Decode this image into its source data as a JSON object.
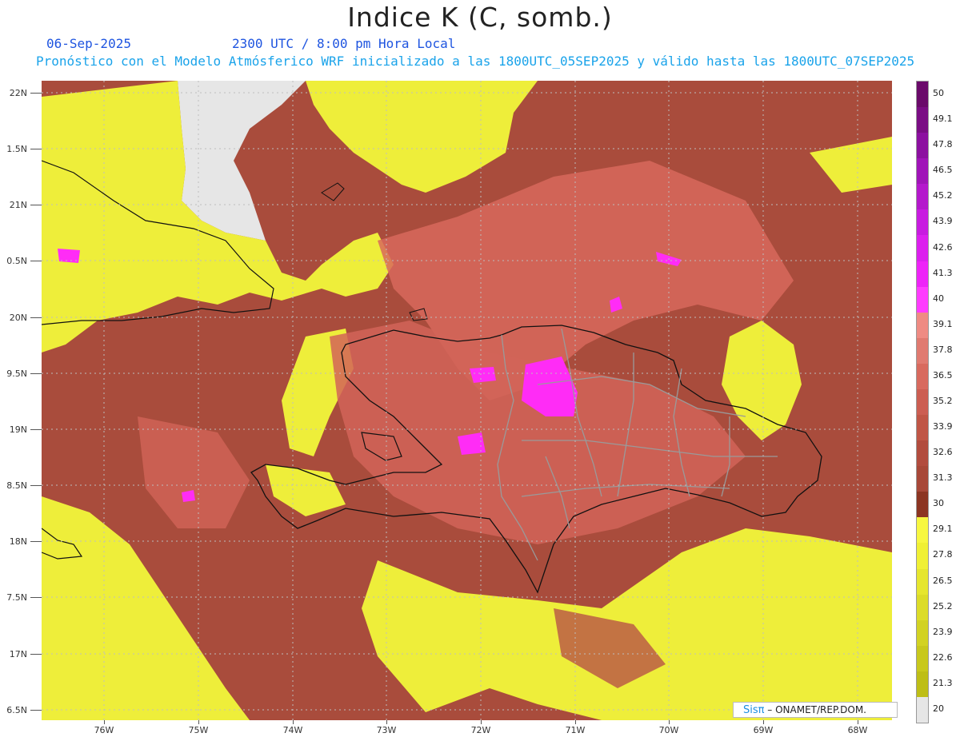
{
  "header": {
    "title": "Indice K (C, somb.)",
    "date": "06-Sep-2025",
    "time": "2300 UTC / 8:00 pm Hora Local",
    "model_info": "Pronóstico con el Modelo Atmósferico WRF inicializado a las 1800UTC_05SEP2025 y válido hasta las  1800UTC_07SEP2025"
  },
  "axes": {
    "lat_labels": [
      "22N",
      "1.5N",
      "21N",
      "0.5N",
      "20N",
      "9.5N",
      "19N",
      "8.5N",
      "18N",
      "7.5N",
      "17N",
      "6.5N"
    ],
    "lon_labels": [
      "76W",
      "75W",
      "74W",
      "73W",
      "72W",
      "71W",
      "70W",
      "69W",
      "68W"
    ]
  },
  "colorbar": {
    "labels": [
      "50",
      "49.1",
      "47.8",
      "46.5",
      "45.2",
      "43.9",
      "42.6",
      "41.3",
      "40",
      "39.1",
      "37.8",
      "36.5",
      "35.2",
      "33.9",
      "32.6",
      "31.3",
      "30",
      "29.1",
      "27.8",
      "26.5",
      "25.2",
      "23.9",
      "22.6",
      "21.3",
      "20"
    ],
    "colors": [
      "#6a0a6a",
      "#7a0d84",
      "#8c10a0",
      "#a014b8",
      "#b418cc",
      "#c81ce0",
      "#dc20ee",
      "#ee24f8",
      "#ff3cff",
      "#ef8b83",
      "#e07a70",
      "#d86a5e",
      "#cc5e52",
      "#c05646",
      "#b24c3e",
      "#a84838",
      "#8c3522",
      "#f7f740",
      "#f0f034",
      "#e6e62e",
      "#dcdc28",
      "#d2d222",
      "#c8c81c",
      "#bebe16",
      "#e6e6e6"
    ]
  },
  "credit": {
    "logo": "Sisπ",
    "org": " – ONAMET/REP.DOM."
  }
}
